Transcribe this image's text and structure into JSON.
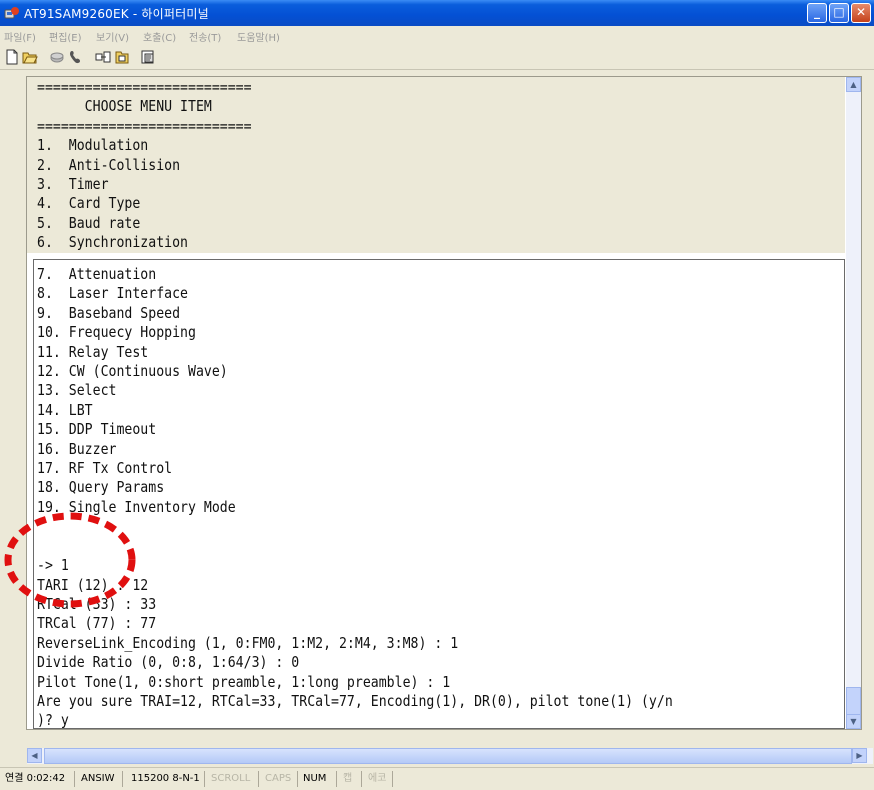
{
  "window": {
    "title": "AT91SAM9260EK - 하이퍼터미널",
    "controls": {
      "minimize": "_",
      "maximize": "□",
      "close": "✕"
    }
  },
  "menu": [
    "파일(F)",
    "편집(E)",
    "보기(V)",
    "호출(C)",
    "전송(T)",
    "도움말(H)"
  ],
  "toolbar": {
    "buttons": [
      "new-icon",
      "open-icon",
      "disconnect-icon",
      "phone-icon",
      "send-icon",
      "receive-icon",
      "properties-icon"
    ]
  },
  "terminal": {
    "scrollback_lines": [
      "===========================",
      "      CHOOSE MENU ITEM",
      "===========================",
      "1.  Modulation",
      "2.  Anti-Collision",
      "3.  Timer",
      "4.  Card Type",
      "5.  Baud rate",
      "6.  Synchronization"
    ],
    "live_lines": [
      "7.  Attenuation",
      "8.  Laser Interface",
      "9.  Baseband Speed",
      "10. Frequecy Hopping",
      "11. Relay Test",
      "12. CW (Continuous Wave)",
      "13. Select",
      "14. LBT",
      "15. DDP Timeout",
      "16. Buzzer",
      "17. RF Tx Control",
      "18. Query Params",
      "19. Single Inventory Mode",
      "",
      "",
      "-> 1",
      "TARI (12) : 12",
      "RTCal (33) : 33",
      "TRCal (77) : 77",
      "ReverseLink_Encoding (1, 0:FM0, 1:M2, 2:M4, 3:M8) : 1",
      "Divide Ratio (0, 0:8, 1:64/3) : 0",
      "Pilot Tone(1, 0:short preamble, 1:long preamble) : 1",
      "Are you sure TRAI=12, RTCal=33, TRCal=77, Encoding(1), DR(0), pilot tone(1) (y/n",
      ")? y"
    ]
  },
  "statusbar": {
    "connection": "연결 0:02:42",
    "emulation": "ANSIW",
    "port_settings": "115200 8-N-1",
    "scroll": "SCROLL",
    "caps": "CAPS",
    "num": "NUM",
    "capture": "캡",
    "echo": "에코"
  },
  "colors": {
    "titlebar": "#0a5ddc",
    "annotation": "#e01010",
    "window_bg": "#ece9d8"
  }
}
